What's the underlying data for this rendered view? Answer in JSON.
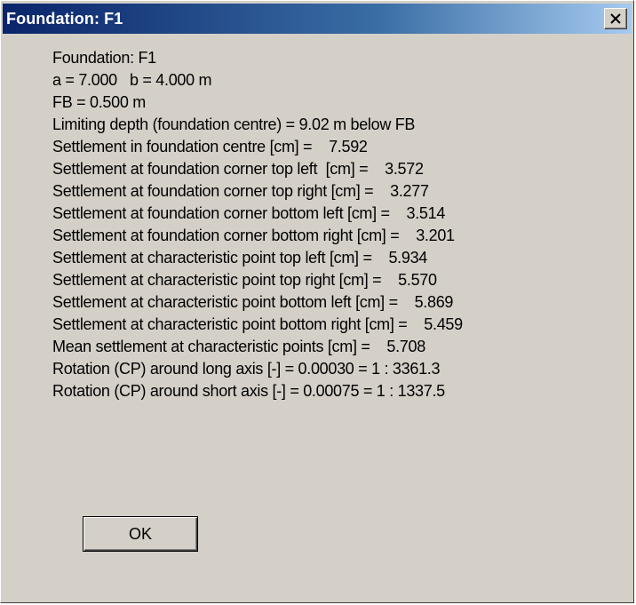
{
  "window": {
    "title": "Foundation: F1",
    "close_icon": "close-icon"
  },
  "results": [
    "Foundation: F1",
    "a = 7.000   b = 4.000 m",
    "FB = 0.500 m",
    "Limiting depth (foundation centre) = 9.02 m below FB",
    "Settlement in foundation centre [cm] =    7.592",
    "Settlement at foundation corner top left  [cm] =    3.572",
    "Settlement at foundation corner top right [cm] =    3.277",
    "Settlement at foundation corner bottom left [cm] =    3.514",
    "Settlement at foundation corner bottom right [cm] =    3.201",
    "Settlement at characteristic point top left [cm] =    5.934",
    "Settlement at characteristic point top right [cm] =    5.570",
    "Settlement at characteristic point bottom left [cm] =    5.869",
    "Settlement at characteristic point bottom right [cm] =    5.459",
    "Mean settlement at characteristic points [cm] =    5.708",
    "Rotation (CP) around long axis [-] = 0.00030 = 1 : 3361.3",
    "Rotation (CP) around short axis [-] = 0.00075 = 1 : 1337.5"
  ],
  "buttons": {
    "ok_label": "OK"
  }
}
